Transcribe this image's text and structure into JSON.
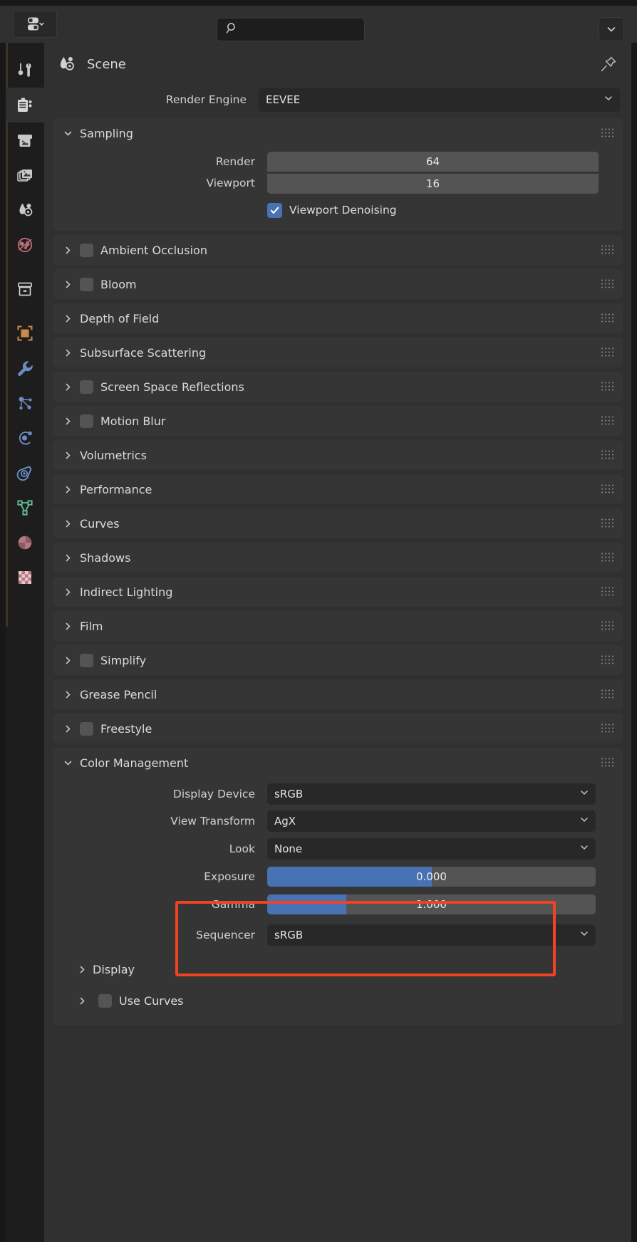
{
  "topbar": {
    "editor_type_icon": "editor-type-icon",
    "search": {
      "value": "",
      "placeholder": "",
      "icon": "search-icon"
    },
    "menu_icon": "chevron-down-icon"
  },
  "rail": {
    "items": [
      {
        "name": "tool",
        "icon": "tool-icon",
        "active": false
      },
      {
        "name": "render",
        "icon": "render-camera-icon",
        "active": true
      },
      {
        "name": "output",
        "icon": "output-printer-icon",
        "active": false
      },
      {
        "name": "view-layer",
        "icon": "view-layer-images-icon",
        "active": false
      },
      {
        "name": "scene",
        "icon": "scene-droplet-icon",
        "active": false
      },
      {
        "name": "world",
        "icon": "world-globe-icon",
        "active": false
      },
      {
        "name": "collection",
        "icon": "collection-box-icon",
        "active": false
      },
      {
        "name": "object",
        "icon": "object-square-icon",
        "active": false
      },
      {
        "name": "modifiers",
        "icon": "wrench-icon",
        "active": false
      },
      {
        "name": "particles",
        "icon": "particles-icon",
        "active": false
      },
      {
        "name": "physics",
        "icon": "physics-orbit-icon",
        "active": false
      },
      {
        "name": "object-constraints",
        "icon": "constraints-icon",
        "active": false
      },
      {
        "name": "object-data",
        "icon": "mesh-data-icon",
        "active": false
      },
      {
        "name": "material",
        "icon": "material-sphere-icon",
        "active": false
      },
      {
        "name": "texture",
        "icon": "texture-checker-icon",
        "active": false
      }
    ]
  },
  "breadcrumb": {
    "icon": "scene-droplet-icon",
    "label": "Scene",
    "pin_icon": "pin-icon"
  },
  "render_engine": {
    "label": "Render Engine",
    "value": "EEVEE"
  },
  "sampling": {
    "title": "Sampling",
    "render_label": "Render",
    "render_value": "64",
    "viewport_label": "Viewport",
    "viewport_value": "16",
    "denoising_label": "Viewport Denoising",
    "denoising_checked": true
  },
  "collapsed_panels": [
    {
      "title": "Ambient Occlusion",
      "has_checkbox": true,
      "checked": false
    },
    {
      "title": "Bloom",
      "has_checkbox": true,
      "checked": false
    },
    {
      "title": "Depth of Field",
      "has_checkbox": false,
      "checked": false
    },
    {
      "title": "Subsurface Scattering",
      "has_checkbox": false,
      "checked": false
    },
    {
      "title": "Screen Space Reflections",
      "has_checkbox": true,
      "checked": false
    },
    {
      "title": "Motion Blur",
      "has_checkbox": true,
      "checked": false
    },
    {
      "title": "Volumetrics",
      "has_checkbox": false,
      "checked": false
    },
    {
      "title": "Performance",
      "has_checkbox": false,
      "checked": false
    },
    {
      "title": "Curves",
      "has_checkbox": false,
      "checked": false
    },
    {
      "title": "Shadows",
      "has_checkbox": false,
      "checked": false
    },
    {
      "title": "Indirect Lighting",
      "has_checkbox": false,
      "checked": false
    },
    {
      "title": "Film",
      "has_checkbox": false,
      "checked": false
    },
    {
      "title": "Simplify",
      "has_checkbox": true,
      "checked": false
    },
    {
      "title": "Grease Pencil",
      "has_checkbox": false,
      "checked": false
    },
    {
      "title": "Freestyle",
      "has_checkbox": true,
      "checked": false
    }
  ],
  "color_management": {
    "title": "Color Management",
    "display_device": {
      "label": "Display Device",
      "value": "sRGB"
    },
    "view_transform": {
      "label": "View Transform",
      "value": "AgX"
    },
    "look": {
      "label": "Look",
      "value": "None"
    },
    "exposure": {
      "label": "Exposure",
      "value": "0.000",
      "fill_percent": 50
    },
    "gamma": {
      "label": "Gamma",
      "value": "1.000",
      "fill_percent": 24
    },
    "sequencer": {
      "label": "Sequencer",
      "value": "sRGB"
    },
    "display_sub": {
      "label": "Display"
    },
    "use_curves_sub": {
      "label": "Use Curves",
      "checked": false
    }
  },
  "highlight": {
    "color": "#f04324",
    "targets": [
      "look",
      "exposure",
      "gamma"
    ]
  }
}
